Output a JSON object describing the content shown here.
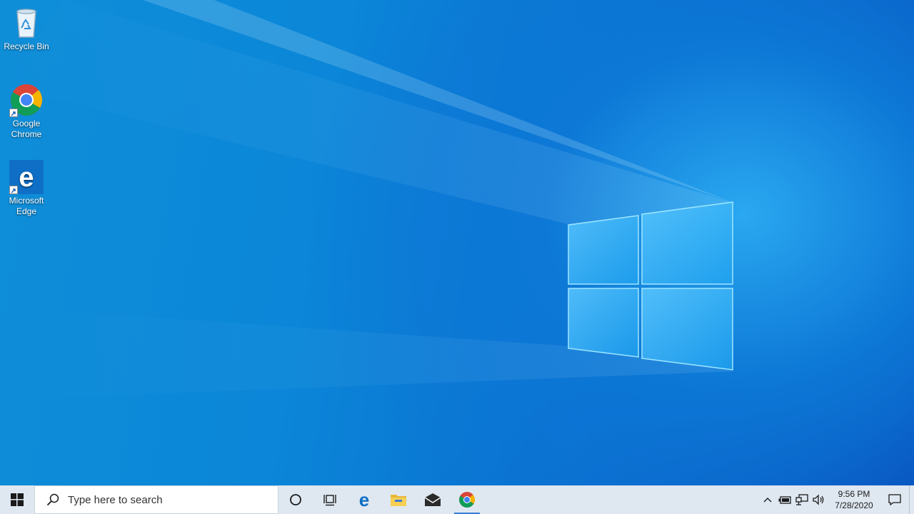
{
  "desktop": {
    "icons": [
      {
        "label": "Recycle Bin",
        "icon": "recycle-bin-icon"
      },
      {
        "label": "Google Chrome",
        "icon": "chrome-icon"
      },
      {
        "label": "Microsoft Edge",
        "icon": "edge-icon"
      }
    ]
  },
  "taskbar": {
    "search_placeholder": "Type here to search",
    "pinned": [
      {
        "name": "cortana",
        "icon": "cortana-circle-icon"
      },
      {
        "name": "task-view",
        "icon": "task-view-icon"
      },
      {
        "name": "edge",
        "icon": "edge-icon"
      },
      {
        "name": "file-explorer",
        "icon": "folder-icon"
      },
      {
        "name": "mail",
        "icon": "mail-icon"
      },
      {
        "name": "chrome",
        "icon": "chrome-icon",
        "active": true
      }
    ],
    "tray": {
      "icons": [
        "chevron-up-icon",
        "battery-icon",
        "network-icon",
        "volume-icon"
      ],
      "time": "9:56 PM",
      "date": "7/28/2020"
    }
  },
  "colors": {
    "wallpaper_blue": "#0b86d8",
    "taskbar": "#dfe8f1",
    "edge_blue": "#0f6fc6",
    "accent": "#3a7bd5"
  }
}
